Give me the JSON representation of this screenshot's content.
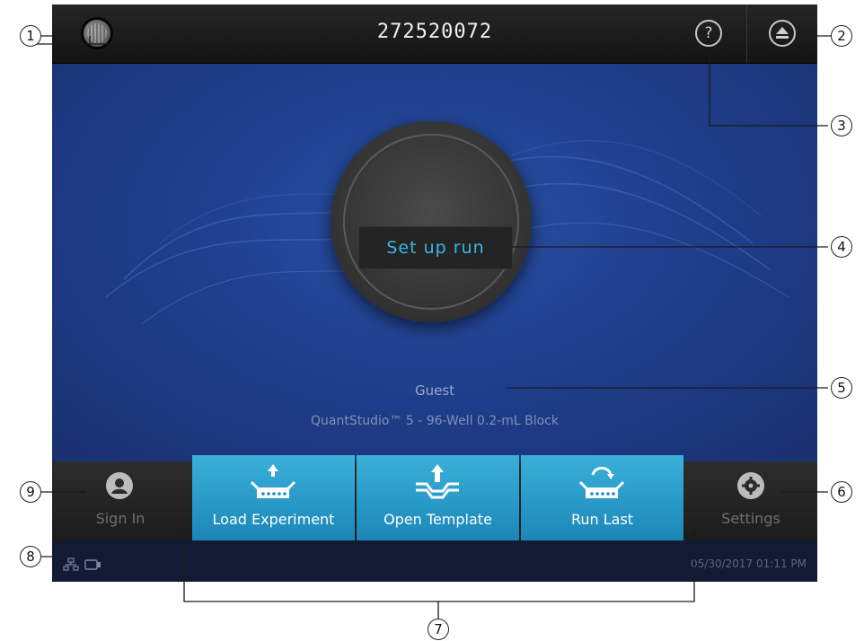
{
  "topbar": {
    "logo_icon": "instrument-logo-icon",
    "serial_number": "272520072",
    "help_icon": "help-icon",
    "eject_icon": "eject-icon"
  },
  "main": {
    "setup_button_label": "Set up run",
    "user": "Guest",
    "instrument": "QuantStudio™ 5 - 96-Well 0.2-mL Block"
  },
  "bottombar": {
    "sign_in_label": "Sign In",
    "actions": [
      {
        "label": "Load Experiment",
        "icon": "load-experiment-icon"
      },
      {
        "label": "Open Template",
        "icon": "open-template-icon"
      },
      {
        "label": "Run Last",
        "icon": "run-last-icon"
      }
    ],
    "settings_label": "Settings"
  },
  "statusbar": {
    "network_icon": "network-icon",
    "device_icon": "usb-device-icon",
    "datetime": "05/30/2017  01:11 PM"
  },
  "callouts": [
    "1",
    "2",
    "3",
    "4",
    "5",
    "6",
    "7",
    "8",
    "9"
  ],
  "colors": {
    "accent_blue": "#39b5e6",
    "action_tile": "#2a9fcf",
    "background_blue": "#1f3f8d"
  }
}
